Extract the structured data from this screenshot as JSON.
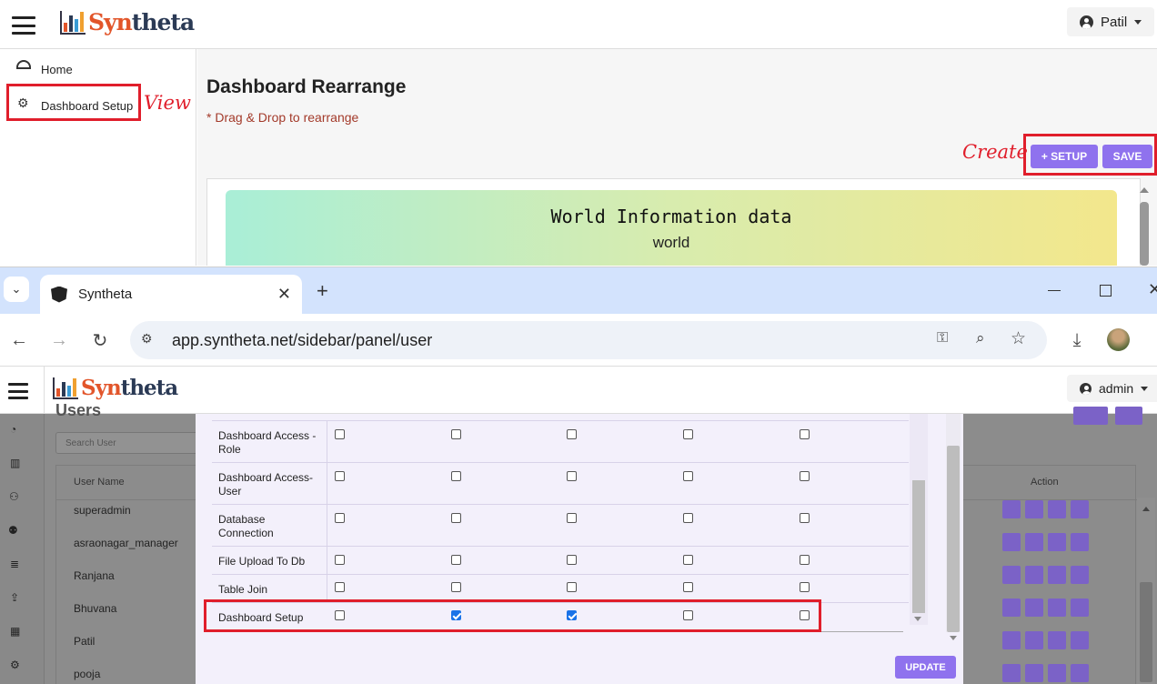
{
  "top_app": {
    "brand": {
      "part1": "Syn",
      "part2": "theta"
    },
    "user": "Patil",
    "sidebar": [
      {
        "label": "Home",
        "icon": "dashboard-gauge-icon"
      },
      {
        "label": "Dashboard Setup",
        "icon": "gear-icon"
      }
    ],
    "page_title": "Dashboard Rearrange",
    "hint": "* Drag & Drop to rearrange",
    "buttons": {
      "setup": "+ SETUP",
      "save": "SAVE"
    },
    "card": {
      "title": "World Information data",
      "subtitle": "world"
    },
    "annotations": {
      "view": "View",
      "create": "Create"
    }
  },
  "browser": {
    "tab_title": "Syntheta",
    "new_tab": "+",
    "url": "app.syntheta.net/sidebar/panel/user"
  },
  "inner_app": {
    "brand": {
      "part1": "Syn",
      "part2": "theta"
    },
    "user": "admin",
    "page_title_partial": "Users",
    "search_placeholder": "Search User",
    "columns": {
      "name": "User Name",
      "action": "Action"
    },
    "users": [
      "superadmin",
      "asraonagar_manager",
      "Ranjana",
      "Bhuvana",
      "Patil",
      "pooja"
    ],
    "permissions": [
      {
        "label": "Dashboard Access - Role",
        "checks": [
          false,
          false,
          false,
          false,
          false
        ]
      },
      {
        "label": "Dashboard Access- User",
        "checks": [
          false,
          false,
          false,
          false,
          false
        ]
      },
      {
        "label": "Database Connection",
        "checks": [
          false,
          false,
          false,
          false,
          false
        ]
      },
      {
        "label": "File Upload To Db",
        "checks": [
          false,
          false,
          false,
          false,
          false
        ]
      },
      {
        "label": "Table Join",
        "checks": [
          false,
          false,
          false,
          false,
          false
        ]
      },
      {
        "label": "Dashboard Setup",
        "checks": [
          false,
          true,
          true,
          false,
          false
        ]
      }
    ],
    "update_button": "UPDATE"
  },
  "colors": {
    "accent": "#8f72ee",
    "annotation": "#e01e2b",
    "hint": "#a33a2a"
  }
}
